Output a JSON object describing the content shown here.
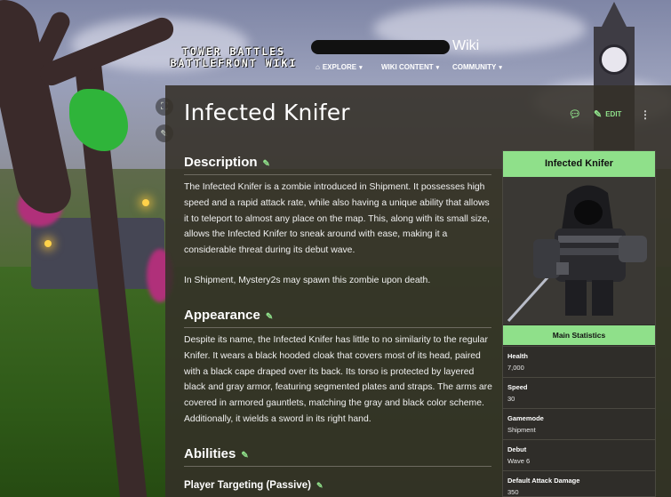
{
  "header": {
    "site_logo_line1": "TOWER BATTLES",
    "site_logo_line2": "BATTLEFRONT WIKI",
    "wiki_label": "Wiki",
    "nav": [
      {
        "icon": "explore-icon",
        "label": "EXPLORE"
      },
      {
        "label": "WIKI CONTENT"
      },
      {
        "label": "COMMUNITY"
      }
    ]
  },
  "page": {
    "title": "Infected Knifer",
    "tools": {
      "edit_label": "EDIT"
    }
  },
  "sections": {
    "description": {
      "heading": "Description",
      "para1": "The Infected Knifer is a zombie introduced in Shipment. It possesses high speed and a rapid attack rate, while also having a unique ability that allows it to teleport to almost any place on the map. This, along with its small size, allows the Infected Knifer to sneak around with ease, making it a considerable threat during its debut wave.",
      "para2": "In Shipment, Mystery2s may spawn this zombie upon death."
    },
    "appearance": {
      "heading": "Appearance",
      "para": "Despite its name, the Infected Knifer has little to no similarity to the regular Knifer. It wears a black hooded cloak that covers most of its head, paired with a black cape draped over its back. Its torso is protected by layered black and gray armor, featuring segmented plates and straps. The arms are covered in armored gauntlets, matching the gray and black color scheme. Additionally, it wields a sword in its right hand."
    },
    "abilities": {
      "heading": "Abilities",
      "sub": "Player Targeting (Passive)"
    }
  },
  "infobox": {
    "title": "Infected Knifer",
    "stats_heading": "Main Statistics",
    "rows": [
      {
        "key": "Health",
        "value": "7,000"
      },
      {
        "key": "Speed",
        "value": "30"
      },
      {
        "key": "Gamemode",
        "value": "Shipment"
      },
      {
        "key": "Debut",
        "value": "Wave 6"
      },
      {
        "key": "Default Attack Damage",
        "value": "350"
      }
    ]
  },
  "colors": {
    "accent": "#8fe08a",
    "panel": "#34302a"
  }
}
